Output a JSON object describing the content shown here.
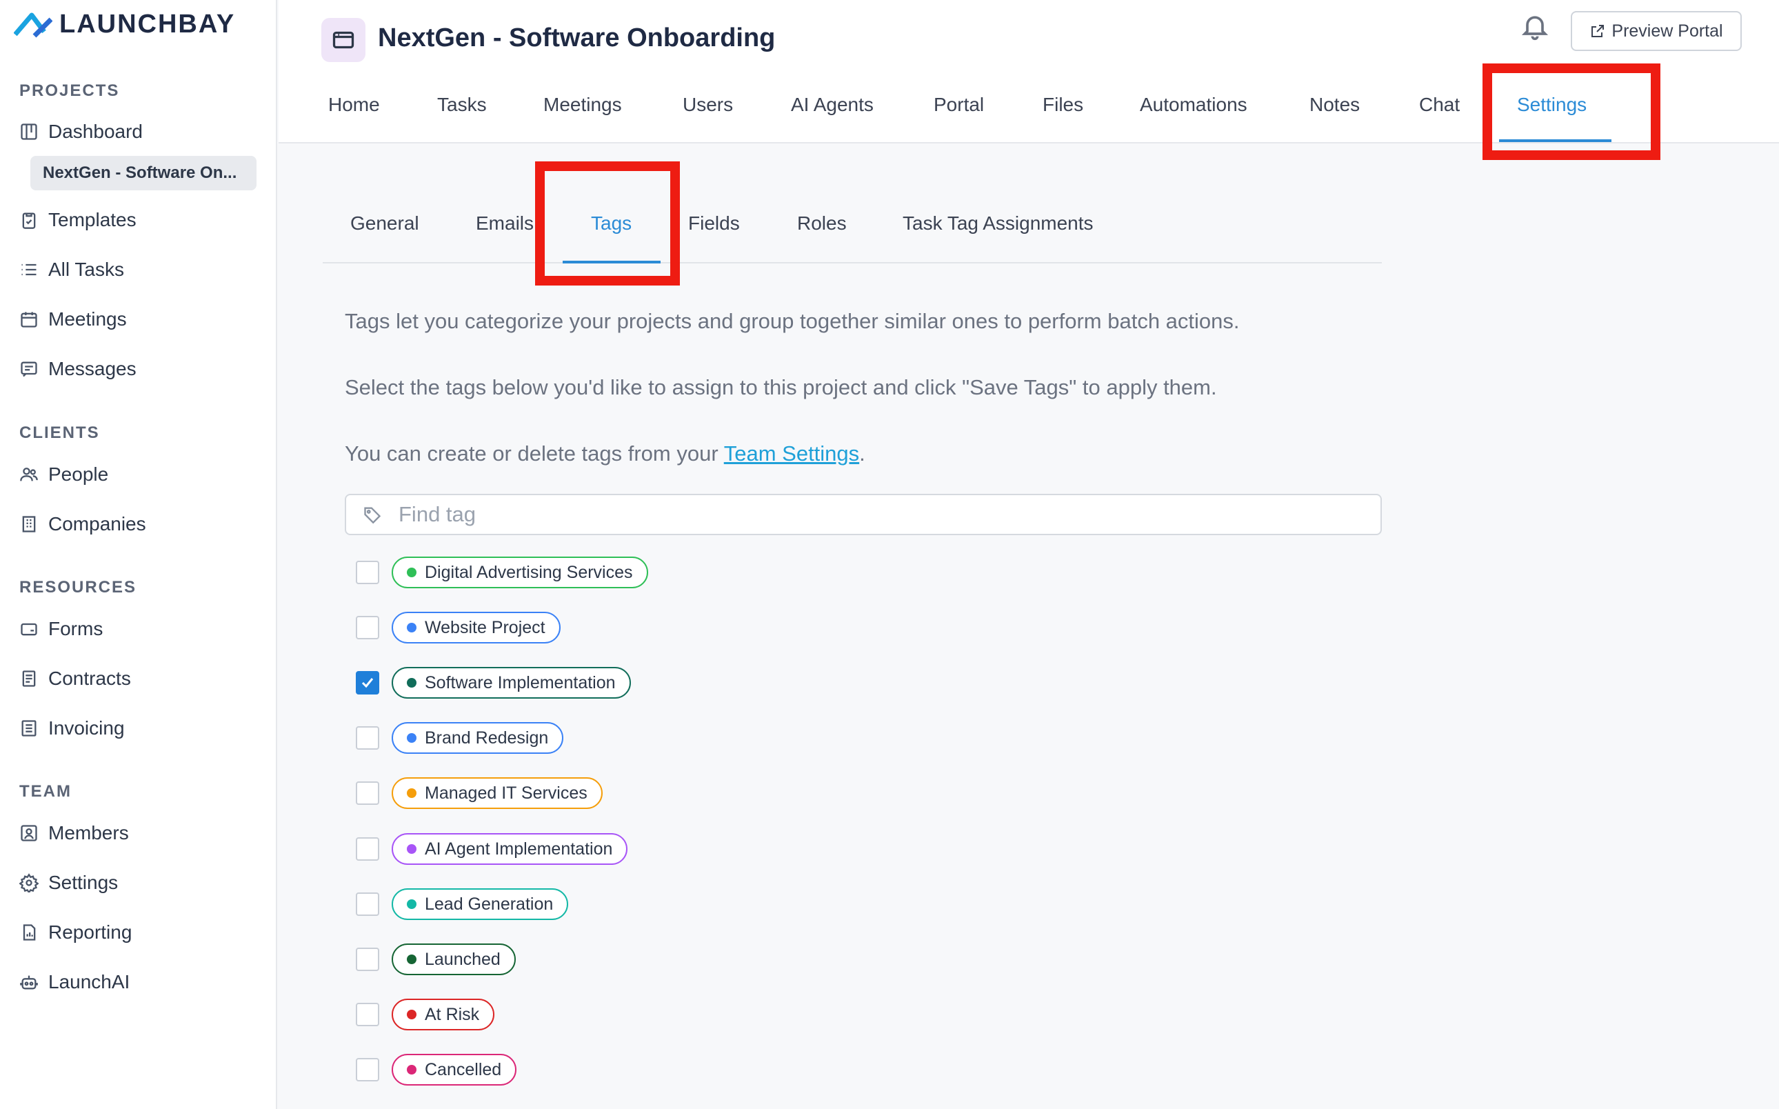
{
  "brand": {
    "name": "LAUNCHBAY"
  },
  "sidebar": {
    "sections": {
      "projects": "PROJECTS",
      "clients": "CLIENTS",
      "resources": "RESOURCES",
      "team": "TEAM"
    },
    "projects": [
      {
        "label": "Dashboard",
        "icon": "dashboard-icon"
      },
      {
        "label": "NextGen - Software On...",
        "icon": ""
      },
      {
        "label": "Templates",
        "icon": "clipboard-icon"
      },
      {
        "label": "All Tasks",
        "icon": "list-icon"
      },
      {
        "label": "Meetings",
        "icon": "calendar-icon"
      },
      {
        "label": "Messages",
        "icon": "message-icon"
      }
    ],
    "clients": [
      {
        "label": "People",
        "icon": "people-icon"
      },
      {
        "label": "Companies",
        "icon": "building-icon"
      }
    ],
    "resources": [
      {
        "label": "Forms",
        "icon": "form-icon"
      },
      {
        "label": "Contracts",
        "icon": "document-icon"
      },
      {
        "label": "Invoicing",
        "icon": "invoice-icon"
      }
    ],
    "team": [
      {
        "label": "Members",
        "icon": "members-icon"
      },
      {
        "label": "Settings",
        "icon": "gear-icon"
      },
      {
        "label": "Reporting",
        "icon": "report-icon"
      },
      {
        "label": "LaunchAI",
        "icon": "robot-icon"
      }
    ]
  },
  "header": {
    "project_title": "NextGen - Software Onboarding",
    "preview_portal": "Preview Portal",
    "tabs": [
      "Home",
      "Tasks",
      "Meetings",
      "Users",
      "AI Agents",
      "Portal",
      "Files",
      "Automations",
      "Notes",
      "Chat",
      "Settings"
    ],
    "active_tab": "Settings"
  },
  "settings": {
    "subtabs": [
      "General",
      "Emails",
      "Tags",
      "Fields",
      "Roles",
      "Task Tag Assignments"
    ],
    "active_subtab": "Tags",
    "desc1": "Tags let you categorize your projects and group together similar ones to perform batch actions.",
    "desc2": "Select the tags below you'd like to assign to this project and click \"Save Tags\" to apply them.",
    "desc3_prefix": "You can create or delete tags from your ",
    "desc3_link": "Team Settings",
    "desc3_suffix": ".",
    "search_placeholder": "Find tag",
    "tags": [
      {
        "label": "Digital Advertising Services",
        "color": "#2fbf57",
        "checked": false
      },
      {
        "label": "Website Project",
        "color": "#3b82f6",
        "checked": false
      },
      {
        "label": "Software Implementation",
        "color": "#116d5a",
        "checked": true
      },
      {
        "label": "Brand Redesign",
        "color": "#3b82f6",
        "checked": false
      },
      {
        "label": "Managed IT Services",
        "color": "#f59e0b",
        "checked": false
      },
      {
        "label": "AI Agent Implementation",
        "color": "#a855f7",
        "checked": false
      },
      {
        "label": "Lead Generation",
        "color": "#14b8a6",
        "checked": false
      },
      {
        "label": "Launched",
        "color": "#166534",
        "checked": false
      },
      {
        "label": "At Risk",
        "color": "#dc2626",
        "checked": false
      },
      {
        "label": "Cancelled",
        "color": "#db2777",
        "checked": false
      }
    ]
  },
  "colors": {
    "accent": "#2b8bd6",
    "highlight": "#ee1c12"
  }
}
